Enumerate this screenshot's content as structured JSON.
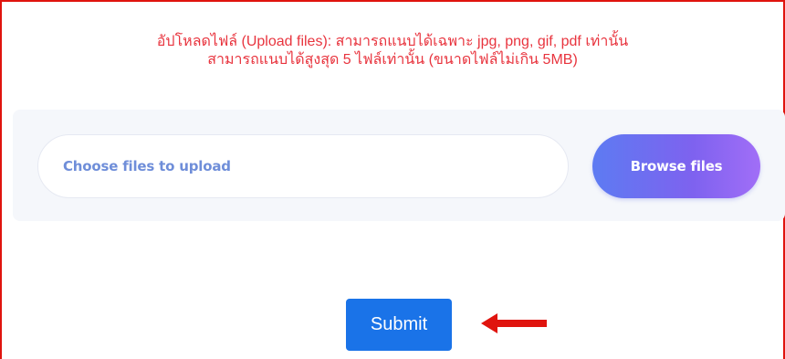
{
  "notice": {
    "line1": "อัปโหลดไฟล์ (Upload files): สามารถแนบได้เฉพาะ jpg, png, gif, pdf เท่านั้น",
    "line2": "สามารถแนบได้สูงสุด 5 ไฟล์เท่านั้น (ขนาดไฟล์ไม่เกิน 5MB)",
    "color": "#e8343e"
  },
  "upload": {
    "placeholder": "Choose files to upload",
    "browse_label": "Browse files"
  },
  "submit": {
    "label": "Submit"
  },
  "annotation": {
    "icon": "left-arrow-icon",
    "color": "#e0140e"
  },
  "colors": {
    "frame_border": "#e0140e",
    "submit_bg": "#1a73e8",
    "browse_gradient_start": "#5d7bf2",
    "browse_gradient_end": "#a16ef7"
  }
}
